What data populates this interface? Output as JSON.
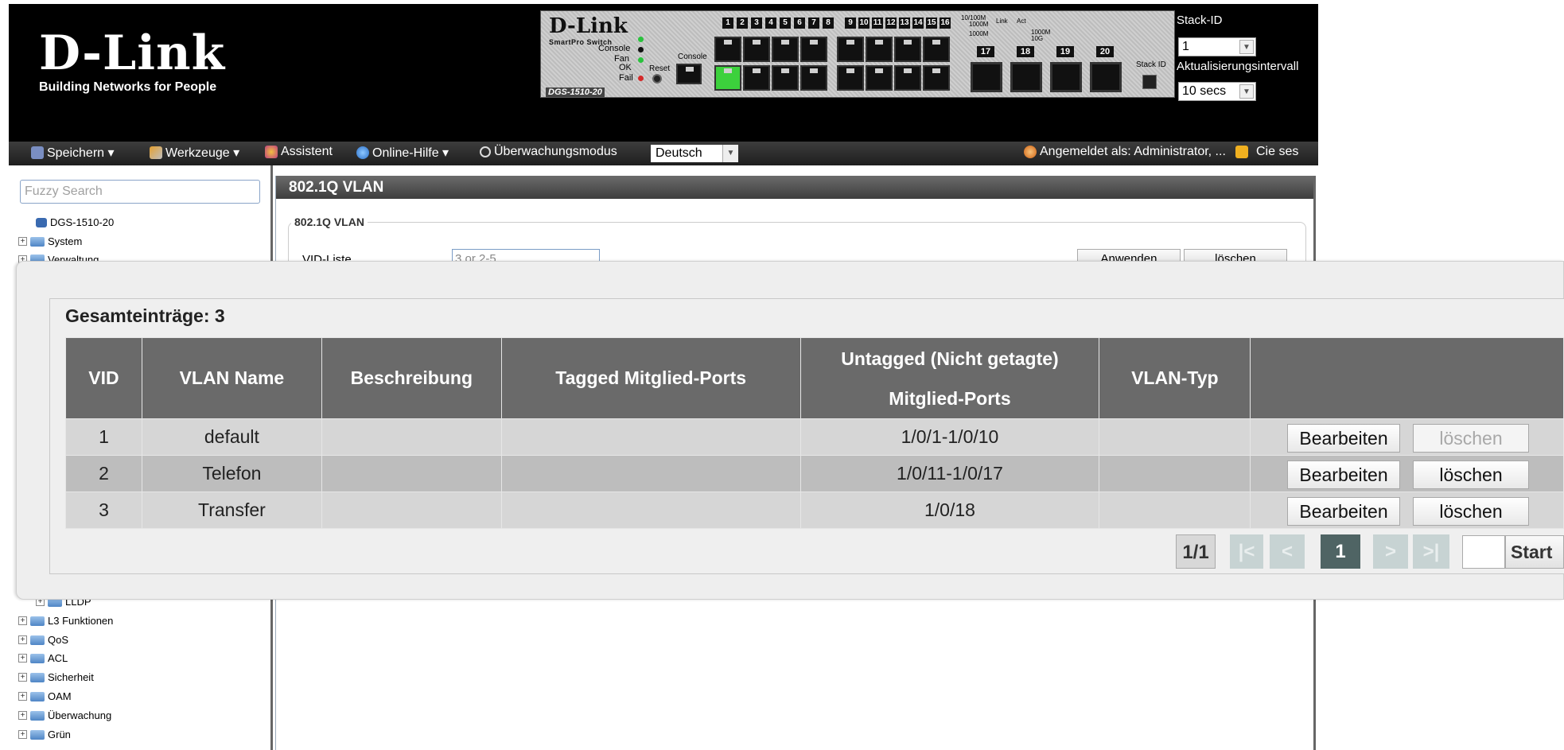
{
  "header": {
    "logo_brand": "D-Link",
    "logo_tagline": "Building Networks for People",
    "switch": {
      "brand": "D-Link",
      "series": "SmartPro Switch",
      "model": "DGS-1510-20",
      "led_labels": [
        "Console",
        "Fan",
        "OK",
        "Fail"
      ],
      "reset_label": "Reset",
      "console_label": "Console",
      "port_numbers_left": [
        "1",
        "2",
        "3",
        "4",
        "5",
        "6",
        "7",
        "8"
      ],
      "port_numbers_right": [
        "9",
        "10",
        "11",
        "12",
        "13",
        "14",
        "15",
        "16"
      ],
      "legend_line1": "10/100M",
      "legend_line2": "1000M",
      "legend_line3": "1000M",
      "link_label": "Link",
      "act_label": "Act",
      "sfp_legend_a": "1000M",
      "sfp_legend_b": "10G",
      "sfp_numbers": [
        "17",
        "18",
        "19",
        "20"
      ],
      "stack_id_label": "Stack ID"
    },
    "stack_id_label": "Stack-ID",
    "stack_id_value": "1",
    "refresh_label": "Aktualisierungsintervall",
    "refresh_value": "10 secs"
  },
  "menubar": {
    "save": "Speichern ▾",
    "tools": "Werkzeuge ▾",
    "wizard": "Assistent",
    "help": "Online-Hilfe ▾",
    "monitor": "Überwachungsmodus",
    "language": "Deutsch",
    "logged_in": "Angemeldet als: Administrator, ...",
    "logout": "Cie ses"
  },
  "sidebar": {
    "search_placeholder": "Fuzzy Search",
    "device": "DGS-1510-20",
    "items_top": [
      "System",
      "Verwaltung"
    ],
    "item_lldp": "LLDP",
    "items_bottom": [
      "L3 Funktionen",
      "QoS",
      "ACL",
      "Sicherheit",
      "OAM",
      "Überwachung",
      "Grün"
    ]
  },
  "content": {
    "title": "802.1Q VLAN",
    "legend": "802.1Q VLAN",
    "vid_label": "VID-Liste",
    "vid_placeholder": "3 or 2-5",
    "apply": "Anwenden",
    "delete": "löschen"
  },
  "overlay": {
    "total_label": "Gesamteinträge: 3",
    "columns": [
      "VID",
      "VLAN Name",
      "Beschreibung",
      "Tagged Mitglied-Ports",
      "Untagged (Nicht getagte)",
      "Mitglied-Ports",
      "VLAN-Typ"
    ],
    "rows": [
      {
        "vid": "1",
        "name": "default",
        "desc": "",
        "tagged": "",
        "untagged": "1/0/1-1/0/10",
        "type": "",
        "edit": "Bearbeiten",
        "delete": "löschen",
        "delete_disabled": true
      },
      {
        "vid": "2",
        "name": "Telefon",
        "desc": "",
        "tagged": "",
        "untagged": "1/0/11-1/0/17",
        "type": "",
        "edit": "Bearbeiten",
        "delete": "löschen",
        "delete_disabled": false
      },
      {
        "vid": "3",
        "name": "Transfer",
        "desc": "",
        "tagged": "",
        "untagged": "1/0/18",
        "type": "",
        "edit": "Bearbeiten",
        "delete": "löschen",
        "delete_disabled": false
      }
    ],
    "pager": {
      "page_info": "1/1",
      "first": "|<",
      "prev": "<",
      "current": "1",
      "next": ">",
      "last": ">|",
      "go_value": "",
      "start": "Start"
    }
  },
  "colors": {
    "header_bg": "#000000",
    "table_header": "#6a6a6a",
    "row_odd": "#d6d6d6",
    "row_even": "#bdbdbd",
    "pager_active": "#4f6464",
    "pager_disabled": "#c7d3d3"
  }
}
